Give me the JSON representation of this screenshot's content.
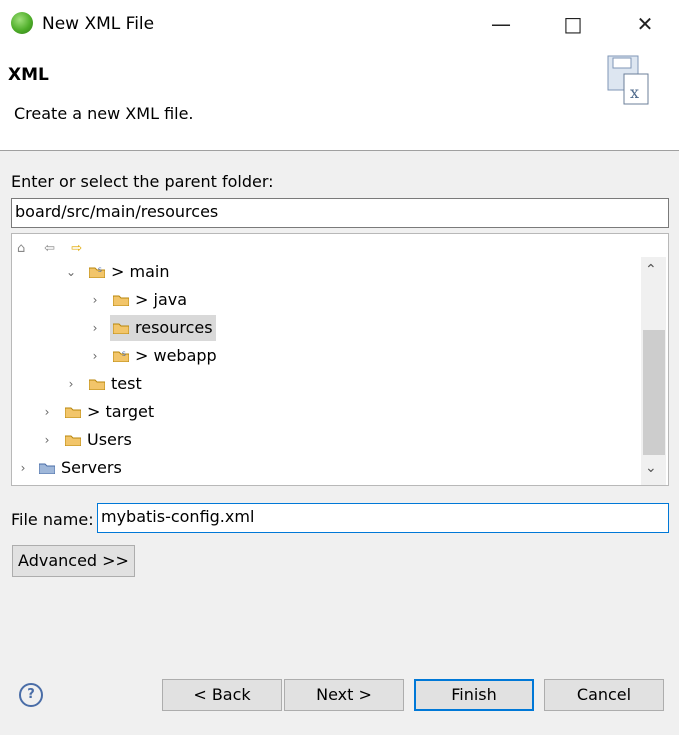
{
  "window": {
    "title": "New XML File",
    "minimize_icon": "minimize-icon",
    "close_icon": "close-icon",
    "maximize_icon": "maximize-icon"
  },
  "header": {
    "title": "XML",
    "description": "Create a new XML file."
  },
  "parent_folder": {
    "label": "Enter or select the parent folder:",
    "value": "board/src/main/resources"
  },
  "tree": {
    "items": [
      {
        "label": "> main",
        "icon": "source-folder-icon",
        "expanded": true
      },
      {
        "label": "> java",
        "icon": "folder-icon",
        "expanded": false
      },
      {
        "label": "resources",
        "icon": "folder-icon",
        "expanded": false,
        "selected": true
      },
      {
        "label": "> webapp",
        "icon": "source-folder-icon",
        "expanded": false
      },
      {
        "label": "test",
        "icon": "folder-icon",
        "expanded": false
      },
      {
        "label": "> target",
        "icon": "folder-icon",
        "expanded": false
      },
      {
        "label": "Users",
        "icon": "folder-icon",
        "expanded": false
      },
      {
        "label": "Servers",
        "icon": "open-folder-icon",
        "expanded": false
      }
    ]
  },
  "file_name": {
    "label": "File name:",
    "value": "mybatis-config.xml"
  },
  "buttons": {
    "advanced": "Advanced >>",
    "back": "< Back",
    "next": "Next >",
    "finish": "Finish",
    "cancel": "Cancel"
  },
  "colors": {
    "accent": "#0078d7",
    "selection": "#d9d9d9"
  }
}
